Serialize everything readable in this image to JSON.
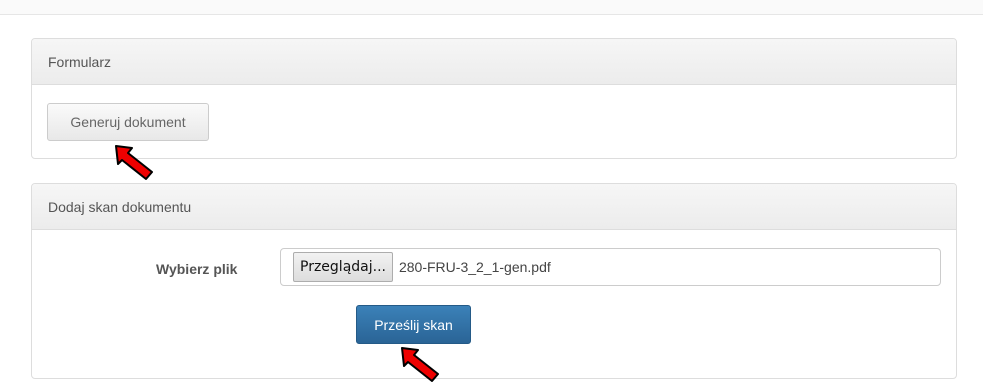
{
  "colors": {
    "accent": "#2a6496",
    "panel_heading_bg": "#ececec",
    "arrow": "#e00000"
  },
  "panel_form": {
    "heading": "Formularz",
    "generate_button": "Generuj dokument"
  },
  "panel_scan": {
    "heading": "Dodaj skan dokumentu",
    "file_label": "Wybierz plik",
    "browse_button": "Przeglądaj...",
    "file_name": "280-FRU-3_2_1-gen.pdf",
    "upload_button": "Prześlij skan"
  },
  "icons": [
    "arrow-pointer-icon"
  ]
}
